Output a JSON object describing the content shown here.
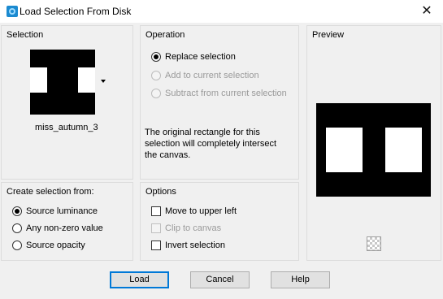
{
  "window": {
    "title": "Load Selection From Disk",
    "close_glyph": "✕",
    "icon": "psp-app-icon"
  },
  "selection": {
    "title": "Selection",
    "name": "miss_autumn_3"
  },
  "operation": {
    "title": "Operation",
    "options": [
      {
        "label": "Replace selection",
        "checked": true,
        "enabled": true
      },
      {
        "label": "Add to current selection",
        "checked": false,
        "enabled": false
      },
      {
        "label": "Subtract from current selection",
        "checked": false,
        "enabled": false
      }
    ],
    "description": "The original rectangle for this selection will completely intersect the canvas."
  },
  "preview": {
    "title": "Preview"
  },
  "create_from": {
    "title": "Create selection from:",
    "options": [
      {
        "label": "Source luminance",
        "checked": true
      },
      {
        "label": "Any non-zero value",
        "checked": false
      },
      {
        "label": "Source opacity",
        "checked": false
      }
    ]
  },
  "options": {
    "title": "Options",
    "items": [
      {
        "label": "Move to upper left",
        "checked": false,
        "enabled": true
      },
      {
        "label": "Clip to canvas",
        "checked": false,
        "enabled": false
      },
      {
        "label": "Invert selection",
        "checked": false,
        "enabled": true
      }
    ]
  },
  "buttons": {
    "load": "Load",
    "cancel": "Cancel",
    "help": "Help"
  },
  "colors": {
    "accent": "#0078d7",
    "preview_bg": "#000000",
    "shape": "#ffffff"
  }
}
